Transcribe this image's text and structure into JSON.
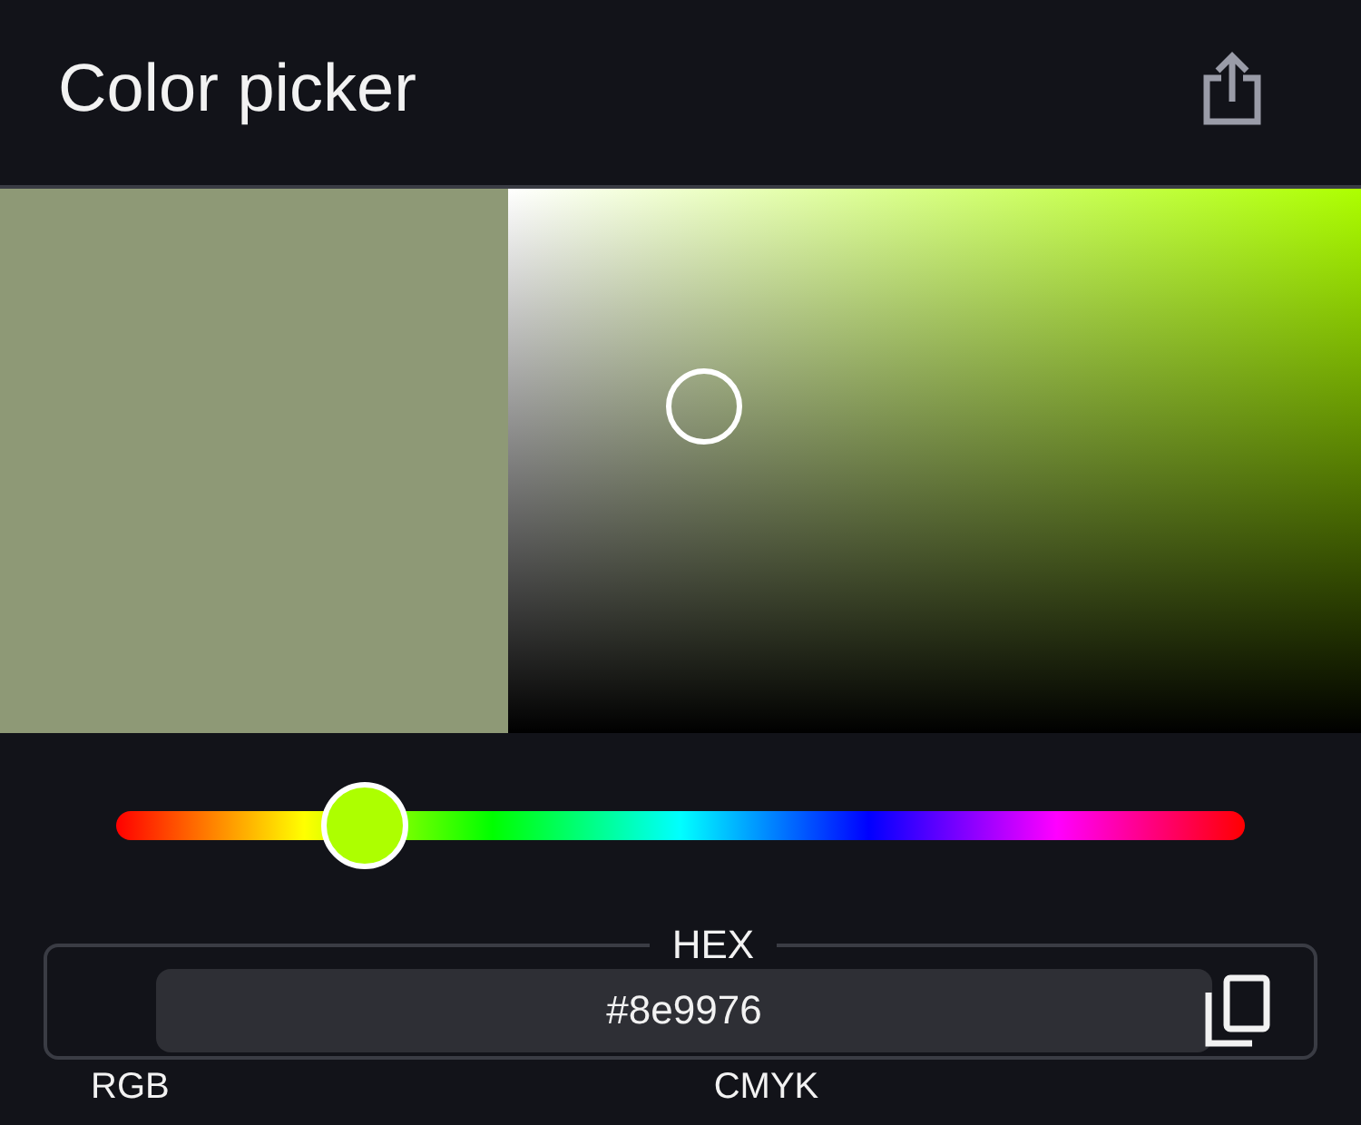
{
  "app_bar": {
    "title": "Color picker"
  },
  "picker": {
    "color": "#8e9976"
  },
  "hue_slider": {
    "level": 0.22
  },
  "hex_field": {
    "label": "HEX",
    "value": "#8e9976"
  },
  "sections": [
    "RGB",
    "CMYK"
  ]
}
